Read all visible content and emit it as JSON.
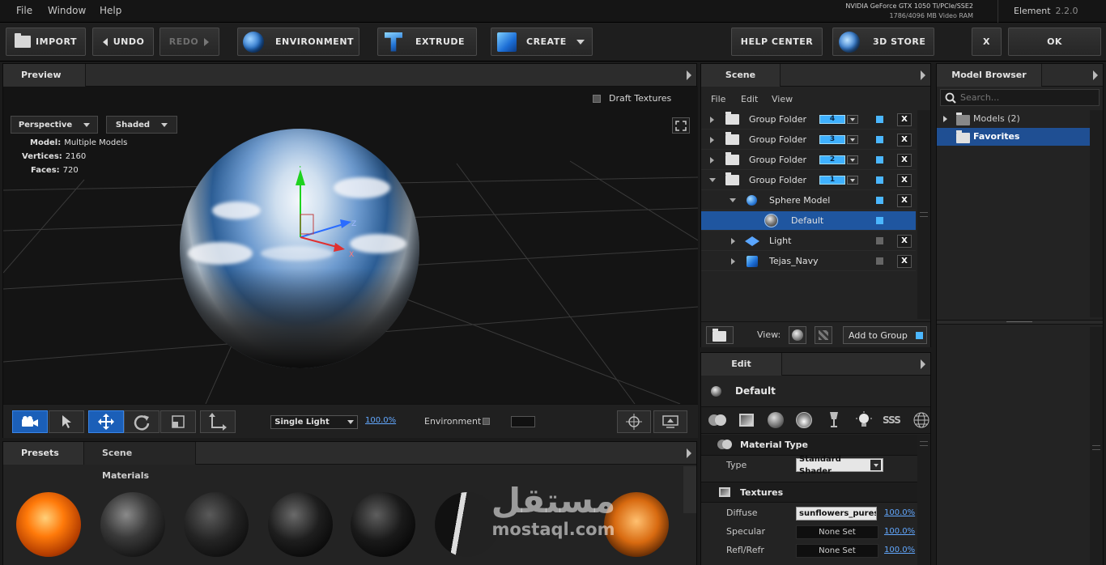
{
  "menubar": {
    "items": [
      "File",
      "Window",
      "Help"
    ],
    "gpu_name": "NVIDIA GeForce GTX 1050 Ti/PCIe/SSE2",
    "gpu_ram": "1786/4096 MB Video RAM",
    "app_name": "Element",
    "app_version": "2.2.0"
  },
  "toolbar": {
    "import": "IMPORT",
    "undo": "UNDO",
    "redo": "REDO",
    "environment": "ENVIRONMENT",
    "extrude": "EXTRUDE",
    "create": "CREATE",
    "help_center": "HELP CENTER",
    "store": "3D STORE",
    "close": "X",
    "ok": "OK"
  },
  "preview": {
    "tab": "Preview",
    "draft_textures": "Draft Textures",
    "camera_mode": "Perspective",
    "render_mode": "Shaded",
    "stats": {
      "model_label": "Model:",
      "model_value": "Multiple Models",
      "vertices_label": "Vertices:",
      "vertices_value": "2160",
      "faces_label": "Faces:",
      "faces_value": "720"
    },
    "axis_y": "Y",
    "axis_z": "Z",
    "axis_x": "X",
    "lighting_mode": "Single Light",
    "light_percent": "100.0%",
    "environment_label": "Environment"
  },
  "presets": {
    "tabs": [
      "Presets",
      "Scene Materials"
    ]
  },
  "scene": {
    "tab": "Scene",
    "menu": [
      "File",
      "Edit",
      "View"
    ],
    "rows": [
      {
        "label": "Group Folder",
        "count": "4"
      },
      {
        "label": "Group Folder",
        "count": "3"
      },
      {
        "label": "Group Folder",
        "count": "2"
      },
      {
        "label": "Group Folder",
        "count": "1"
      },
      {
        "label": "Sphere Model"
      },
      {
        "label": "Default"
      },
      {
        "label": "Light"
      },
      {
        "label": "Tejas_Navy"
      }
    ],
    "view_label": "View:",
    "add_to_group": "Add to Group",
    "delete_label": "X"
  },
  "model_browser": {
    "tab": "Model Browser",
    "search_placeholder": "Search...",
    "models": "Models (2)",
    "favorites": "Favorites"
  },
  "edit": {
    "tab": "Edit",
    "material_name": "Default",
    "sss_label": "SSS",
    "material_type_header": "Material Type",
    "type_label": "Type",
    "type_value": "Standard Shader",
    "textures_header": "Textures",
    "diffuse_label": "Diffuse",
    "diffuse_value": "sunflowers_puresk",
    "diffuse_percent": "100.0%",
    "specular_label": "Specular",
    "specular_value": "None Set",
    "specular_percent": "100.0%",
    "reflrefr_label": "Refl/Refr",
    "reflrefr_value": "None Set",
    "reflrefr_percent": "100.0%"
  },
  "watermark": {
    "arabic": "مستقل",
    "latin": "mostaql.com"
  }
}
